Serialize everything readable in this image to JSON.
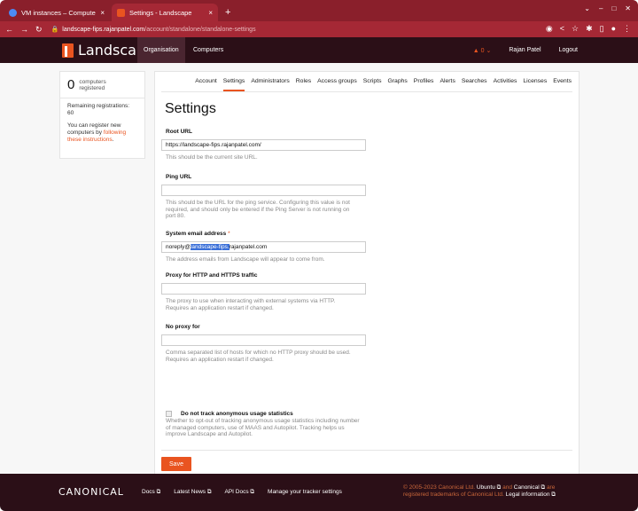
{
  "browser": {
    "tabs": [
      {
        "title": "VM instances – Compute",
        "close": "×",
        "favicon_color": "#4c8bf5"
      },
      {
        "title": "Settings - Landscape",
        "close": "×",
        "favicon_color": "#e95420"
      }
    ],
    "new_tab": "+",
    "window_controls": [
      "⌄",
      "–",
      "□",
      "✕"
    ],
    "url_host": "landscape-fips.rajanpatel.com",
    "url_path": "/account/standalone/standalone-settings"
  },
  "topnav": {
    "brand": "Landscape",
    "items": [
      "Organisation",
      "Computers"
    ],
    "alerts": "▲ 0 ⌄",
    "user": "Rajan Patel",
    "logout": "Logout"
  },
  "sidebar": {
    "count": "0",
    "count_label_1": "computers",
    "count_label_2": "registered",
    "remaining_label": "Remaining registrations:",
    "remaining_value": "60",
    "register_text": "You can register new computers by",
    "register_link": "following these instructions",
    "register_end": "."
  },
  "settings_tabs": [
    "Account",
    "Settings",
    "Administrators",
    "Roles",
    "Access groups",
    "Scripts",
    "Graphs",
    "Profiles",
    "Alerts",
    "Searches",
    "Activities",
    "Licenses",
    "Events"
  ],
  "form": {
    "title": "Settings",
    "root_url": {
      "label": "Root URL",
      "value": "https://landscape-fips.rajanpatel.com/",
      "help": "This should be the current site URL."
    },
    "ping_url": {
      "label": "Ping URL",
      "value": "",
      "help": "This should be the URL for the ping service. Configuring this value is not required, and should only be entered if the Ping Server is not running on port 80."
    },
    "email": {
      "label": "System email address",
      "required": "*",
      "value_pre": "noreply@",
      "value_sel": "landscape-fips.",
      "value_post": "rajanpatel.com",
      "help": "The address emails from Landscape will appear to come from."
    },
    "proxy": {
      "label": "Proxy for HTTP and HTTPS traffic",
      "value": "",
      "help": "The proxy to use when interacting with external systems via HTTP. Requires an application restart if changed."
    },
    "no_proxy": {
      "label": "No proxy for",
      "value": "",
      "help": "Comma separated list of hosts for which no HTTP proxy should be used. Requires an application restart if changed."
    },
    "usage": {
      "label": "Do not track anonymous usage statistics",
      "help": "Whether to opt-out of tracking anonymous usage statistics including number of managed computers, use of MAAS and Autopilot. Tracking helps us improve Landscape and Autopilot."
    },
    "save": "Save"
  },
  "footer": {
    "brand": "CANONICAL",
    "links": [
      "Docs ⧉",
      "Latest News ⧉",
      "API Docs ⧉",
      "Manage your tracker settings"
    ],
    "copyright_1": "© 2005-2023 Canonical Ltd.",
    "ubuntu": "Ubuntu ⧉",
    "and": "and",
    "canonical": "Canonical ⧉",
    "are": "are",
    "copyright_2": "registered trademarks of Canonical Ltd.",
    "legal": "Legal information ⧉"
  }
}
